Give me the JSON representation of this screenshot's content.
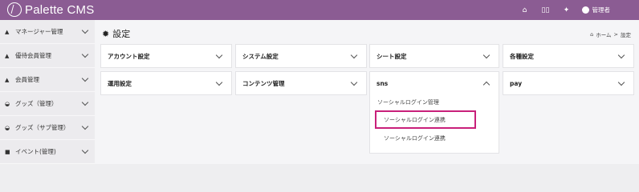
{
  "app": {
    "logo_text": "Palette CMS"
  },
  "topbar": {
    "icons": [
      "home-icon",
      "book-icon",
      "gear-icon"
    ],
    "user_label": "管理者"
  },
  "sidebar": {
    "items": [
      {
        "label": "マネージャー管理",
        "icon": "user-icon"
      },
      {
        "label": "優待会員管理",
        "icon": "users-icon"
      },
      {
        "label": "会員管理",
        "icon": "user-icon"
      },
      {
        "label": "グッズ（管理）",
        "icon": "basket-icon"
      },
      {
        "label": "グッズ（サブ管理）",
        "icon": "basket-icon"
      },
      {
        "label": "イベント(管理)",
        "icon": "calendar-icon"
      }
    ]
  },
  "page": {
    "title": "設定",
    "breadcrumb": {
      "home": "ホーム",
      "separator": ">",
      "current": "設定"
    }
  },
  "settings": {
    "row1": [
      "アカウント設定",
      "システム設定",
      "シート設定",
      "各種設定"
    ],
    "row2": [
      "運用設定",
      "コンテンツ管理",
      "sns",
      "pay"
    ]
  },
  "sns_menu": {
    "items": [
      "ソーシャルログイン管理",
      "ソーシャルログイン連携",
      "ソーシャルログイン連携"
    ],
    "highlight_color": "#c8207a"
  },
  "colors": {
    "topbar": "#8b5c93",
    "sidebar": "#ecebee",
    "main": "#f5f5f7"
  }
}
